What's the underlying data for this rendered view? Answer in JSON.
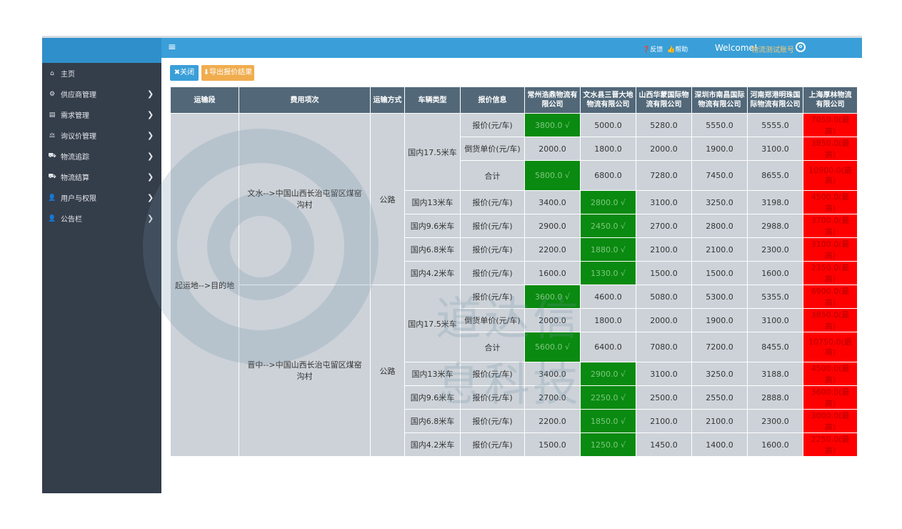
{
  "header": {
    "menu_icon": "menu-icon",
    "feedback": "❓反馈",
    "help": "👍帮助",
    "welcome": "Welcome!",
    "username": "物流测试账号"
  },
  "sidebar": {
    "items": [
      {
        "icon": "⌂",
        "label": "主页",
        "chevron": ""
      },
      {
        "icon": "⚙",
        "label": "供应商管理",
        "chevron": "❯"
      },
      {
        "icon": "▤",
        "label": "需求管理",
        "chevron": "❯"
      },
      {
        "icon": "⚖",
        "label": "询议价管理",
        "chevron": "❯"
      },
      {
        "icon": "⛟",
        "label": "物流追踪",
        "chevron": "❯"
      },
      {
        "icon": "⛟",
        "label": "物流结算",
        "chevron": "❯"
      },
      {
        "icon": "👤",
        "label": "用户与权限",
        "chevron": "❯"
      },
      {
        "icon": "👤",
        "label": "公告栏",
        "chevron": "❯"
      }
    ]
  },
  "toolbar": {
    "close_label": "✖关闭",
    "export_label": "⬇导出报价结果"
  },
  "watermark": {
    "text": "道达信息科技"
  },
  "table": {
    "headers": [
      "运输段",
      "费用项次",
      "运输方式",
      "车辆类型",
      "报价信息",
      "常州浩鼎物流有限公司",
      "文水县三晋大地物流有限公司",
      "山西华蒙国际物流有限公司",
      "深圳市南昌国际物流有限公司",
      "河南郑港明珠国际物流有限公司",
      "上海厚林物流有限公司"
    ],
    "segment": "起运地-->目的地",
    "groups": [
      {
        "route": "文水-->中国山西长治屯留区煤窑沟村",
        "mode": "公路",
        "rows": [
          {
            "vehicle": "国内17.5米车",
            "vspan": 3,
            "info": "报价(元/车)",
            "cells": [
              {
                "v": "3800.0 √",
                "c": "green"
              },
              {
                "v": "5000.0",
                "c": ""
              },
              {
                "v": "5280.0",
                "c": ""
              },
              {
                "v": "5550.0",
                "c": ""
              },
              {
                "v": "5555.0",
                "c": ""
              },
              {
                "v": "7050.0(最高)",
                "c": "red"
              }
            ]
          },
          {
            "vehicle": "",
            "vspan": 0,
            "info": "倒货单价(元/车)",
            "cells": [
              {
                "v": "2000.0",
                "c": ""
              },
              {
                "v": "1800.0",
                "c": ""
              },
              {
                "v": "2000.0",
                "c": ""
              },
              {
                "v": "1900.0",
                "c": ""
              },
              {
                "v": "3100.0",
                "c": ""
              },
              {
                "v": "3850.0(最高)",
                "c": "red"
              }
            ]
          },
          {
            "vehicle": "",
            "vspan": 0,
            "info": "合计",
            "cells": [
              {
                "v": "5800.0 √",
                "c": "green"
              },
              {
                "v": "6800.0",
                "c": ""
              },
              {
                "v": "7280.0",
                "c": ""
              },
              {
                "v": "7450.0",
                "c": ""
              },
              {
                "v": "8655.0",
                "c": ""
              },
              {
                "v": "10900.0(最高)",
                "c": "red"
              }
            ]
          },
          {
            "vehicle": "国内13米车",
            "vspan": 1,
            "info": "报价(元/车)",
            "cells": [
              {
                "v": "3400.0",
                "c": ""
              },
              {
                "v": "2800.0 √",
                "c": "green"
              },
              {
                "v": "3100.0",
                "c": ""
              },
              {
                "v": "3250.0",
                "c": ""
              },
              {
                "v": "3198.0",
                "c": ""
              },
              {
                "v": "4500.0(最高)",
                "c": "red"
              }
            ]
          },
          {
            "vehicle": "国内9.6米车",
            "vspan": 1,
            "info": "报价(元/车)",
            "cells": [
              {
                "v": "2900.0",
                "c": ""
              },
              {
                "v": "2450.0 √",
                "c": "green"
              },
              {
                "v": "2700.0",
                "c": ""
              },
              {
                "v": "2800.0",
                "c": ""
              },
              {
                "v": "2988.0",
                "c": ""
              },
              {
                "v": "3700.0(最高)",
                "c": "red"
              }
            ]
          },
          {
            "vehicle": "国内6.8米车",
            "vspan": 1,
            "info": "报价(元/车)",
            "cells": [
              {
                "v": "2200.0",
                "c": ""
              },
              {
                "v": "1880.0 √",
                "c": "green"
              },
              {
                "v": "2100.0",
                "c": ""
              },
              {
                "v": "2100.0",
                "c": ""
              },
              {
                "v": "2300.0",
                "c": ""
              },
              {
                "v": "3100.0(最高)",
                "c": "red"
              }
            ]
          },
          {
            "vehicle": "国内4.2米车",
            "vspan": 1,
            "info": "报价(元/车)",
            "cells": [
              {
                "v": "1600.0",
                "c": ""
              },
              {
                "v": "1330.0 √",
                "c": "green"
              },
              {
                "v": "1500.0",
                "c": ""
              },
              {
                "v": "1500.0",
                "c": ""
              },
              {
                "v": "1600.0",
                "c": ""
              },
              {
                "v": "2350.0(最高)",
                "c": "red"
              }
            ]
          }
        ]
      },
      {
        "route": "晋中-->中国山西长治屯留区煤窑沟村",
        "mode": "公路",
        "rows": [
          {
            "vehicle": "国内17.5米车",
            "vspan": 3,
            "info": "报价(元/车)",
            "cells": [
              {
                "v": "3600.0 √",
                "c": "green"
              },
              {
                "v": "4600.0",
                "c": ""
              },
              {
                "v": "5080.0",
                "c": ""
              },
              {
                "v": "5300.0",
                "c": ""
              },
              {
                "v": "5355.0",
                "c": ""
              },
              {
                "v": "6900.0(最高)",
                "c": "red"
              }
            ]
          },
          {
            "vehicle": "",
            "vspan": 0,
            "info": "倒货单价(元/车)",
            "cells": [
              {
                "v": "2000.0",
                "c": ""
              },
              {
                "v": "1800.0",
                "c": ""
              },
              {
                "v": "2000.0",
                "c": ""
              },
              {
                "v": "1900.0",
                "c": ""
              },
              {
                "v": "3100.0",
                "c": ""
              },
              {
                "v": "3850.0(最高)",
                "c": "red"
              }
            ]
          },
          {
            "vehicle": "",
            "vspan": 0,
            "info": "合计",
            "cells": [
              {
                "v": "5600.0 √",
                "c": "green"
              },
              {
                "v": "6400.0",
                "c": ""
              },
              {
                "v": "7080.0",
                "c": ""
              },
              {
                "v": "7200.0",
                "c": ""
              },
              {
                "v": "8455.0",
                "c": ""
              },
              {
                "v": "10750.0(最高)",
                "c": "red"
              }
            ]
          },
          {
            "vehicle": "国内13米车",
            "vspan": 1,
            "info": "报价(元/车)",
            "cells": [
              {
                "v": "3400.0",
                "c": ""
              },
              {
                "v": "2900.0 √",
                "c": "green"
              },
              {
                "v": "3100.0",
                "c": ""
              },
              {
                "v": "3250.0",
                "c": ""
              },
              {
                "v": "3188.0",
                "c": ""
              },
              {
                "v": "4500.0(最高)",
                "c": "red"
              }
            ]
          },
          {
            "vehicle": "国内9.6米车",
            "vspan": 1,
            "info": "报价(元/车)",
            "cells": [
              {
                "v": "2700.0",
                "c": ""
              },
              {
                "v": "2250.0 √",
                "c": "green"
              },
              {
                "v": "2500.0",
                "c": ""
              },
              {
                "v": "2550.0",
                "c": ""
              },
              {
                "v": "2888.0",
                "c": ""
              },
              {
                "v": "3600.0(最高)",
                "c": "red"
              }
            ]
          },
          {
            "vehicle": "国内6.8米车",
            "vspan": 1,
            "info": "报价(元/车)",
            "cells": [
              {
                "v": "2200.0",
                "c": ""
              },
              {
                "v": "1850.0 √",
                "c": "green"
              },
              {
                "v": "2100.0",
                "c": ""
              },
              {
                "v": "2100.0",
                "c": ""
              },
              {
                "v": "2300.0",
                "c": ""
              },
              {
                "v": "3000.0(最高)",
                "c": "red"
              }
            ]
          },
          {
            "vehicle": "国内4.2米车",
            "vspan": 1,
            "info": "报价(元/车)",
            "cells": [
              {
                "v": "1500.0",
                "c": ""
              },
              {
                "v": "1250.0 √",
                "c": "green"
              },
              {
                "v": "1450.0",
                "c": ""
              },
              {
                "v": "1400.0",
                "c": ""
              },
              {
                "v": "1600.0",
                "c": ""
              },
              {
                "v": "2250.0(最高)",
                "c": "red"
              }
            ]
          }
        ]
      }
    ]
  }
}
